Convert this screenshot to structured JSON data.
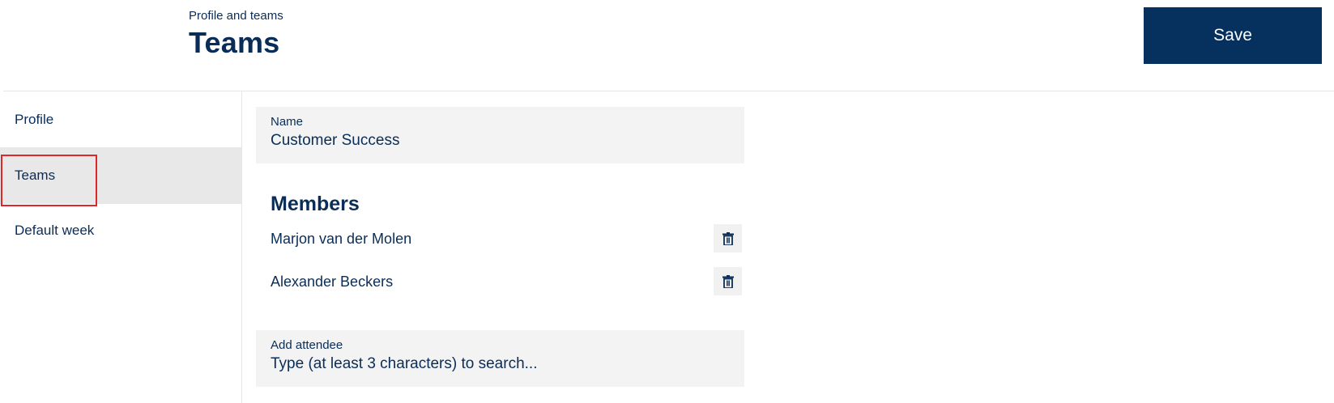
{
  "header": {
    "breadcrumb": "Profile and teams",
    "title": "Teams",
    "save_label": "Save"
  },
  "sidebar": {
    "items": [
      {
        "label": "Profile",
        "active": false
      },
      {
        "label": "Teams",
        "active": true
      },
      {
        "label": "Default week",
        "active": false
      }
    ]
  },
  "team": {
    "name_label": "Name",
    "name_value": "Customer Success"
  },
  "members": {
    "heading": "Members",
    "list": [
      {
        "name": "Marjon van der Molen",
        "action_icon": "trash-icon"
      },
      {
        "name": "Alexander Beckers",
        "action_icon": "trash-icon"
      }
    ]
  },
  "add_attendee": {
    "label": "Add attendee",
    "placeholder": "Type (at least 3 characters) to search..."
  },
  "colors": {
    "primary": "#06305e",
    "text": "#0a2d57",
    "field_bg": "#f3f3f3",
    "active_item_bg": "#e8e8e8",
    "highlight": "#e0262b"
  }
}
